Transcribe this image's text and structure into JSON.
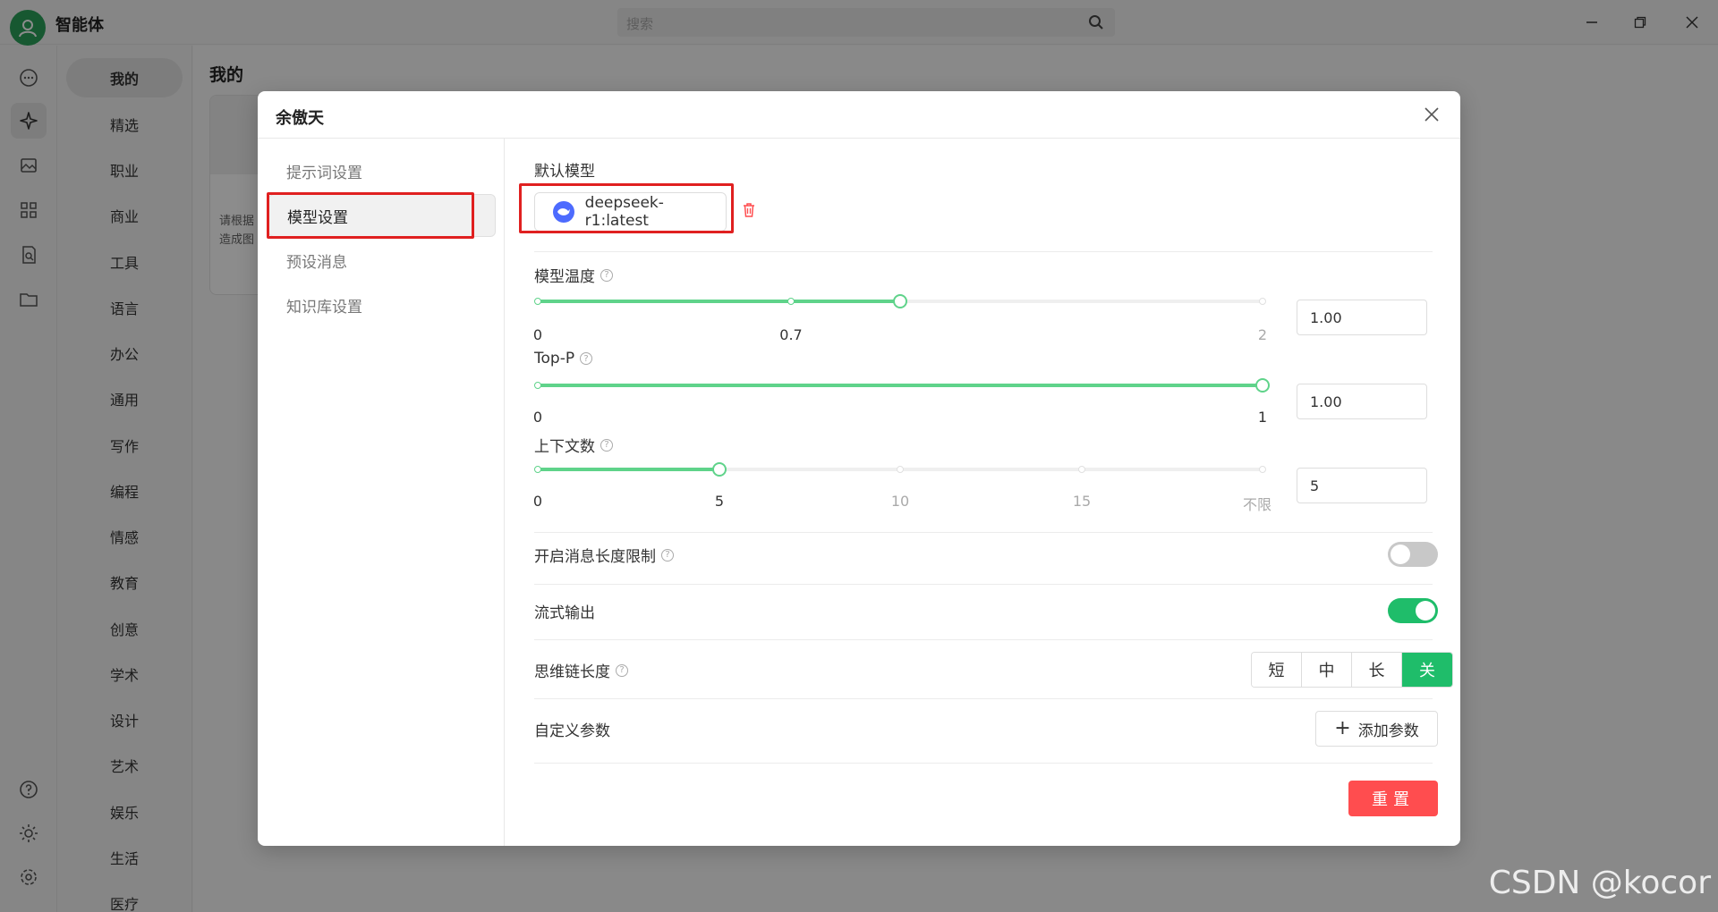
{
  "app": {
    "title": "智能体",
    "search_placeholder": "搜索"
  },
  "categories": [
    "我的",
    "精选",
    "职业",
    "商业",
    "工具",
    "语言",
    "办公",
    "通用",
    "写作",
    "编程",
    "情感",
    "教育",
    "创意",
    "学术",
    "设计",
    "艺术",
    "娱乐",
    "生活",
    "医疗"
  ],
  "content": {
    "title": "我的",
    "card_text": "请根据\n造成图"
  },
  "modal": {
    "title": "余傲天",
    "menu": [
      "提示词设置",
      "模型设置",
      "预设消息",
      "知识库设置"
    ],
    "active_menu": "模型设置",
    "default_model_label": "默认模型",
    "model_name": "deepseek-r1:latest",
    "temperature": {
      "label": "模型温度",
      "value": 1.0,
      "input": "1.00",
      "min": 0,
      "max": 2,
      "ticks": [
        "0",
        "0.7",
        "2"
      ],
      "tick_values": [
        0,
        0.7,
        2
      ]
    },
    "top_p": {
      "label": "Top-P",
      "value": 1.0,
      "input": "1.00",
      "min": 0,
      "max": 1,
      "ticks": [
        "0",
        "1"
      ]
    },
    "context": {
      "label": "上下文数",
      "value": 5,
      "input": "5",
      "ticks": [
        "0",
        "5",
        "10",
        "15",
        "不限"
      ]
    },
    "msg_length_limit": {
      "label": "开启消息长度限制",
      "on": false
    },
    "stream_output": {
      "label": "流式输出",
      "on": true
    },
    "reasoning_length": {
      "label": "思维链长度",
      "options": [
        "短",
        "中",
        "长",
        "关"
      ],
      "selected": "关"
    },
    "custom_params": {
      "label": "自定义参数",
      "add_button": "添加参数"
    },
    "reset_button": "重置"
  },
  "watermark": "CSDN @kocor",
  "colors": {
    "accent_green": "#1fbd6a",
    "slider_green": "#5fd38a",
    "danger_red": "#ff4d4f",
    "highlight_red": "#e02020",
    "deepseek_blue": "#4d6bfe"
  }
}
